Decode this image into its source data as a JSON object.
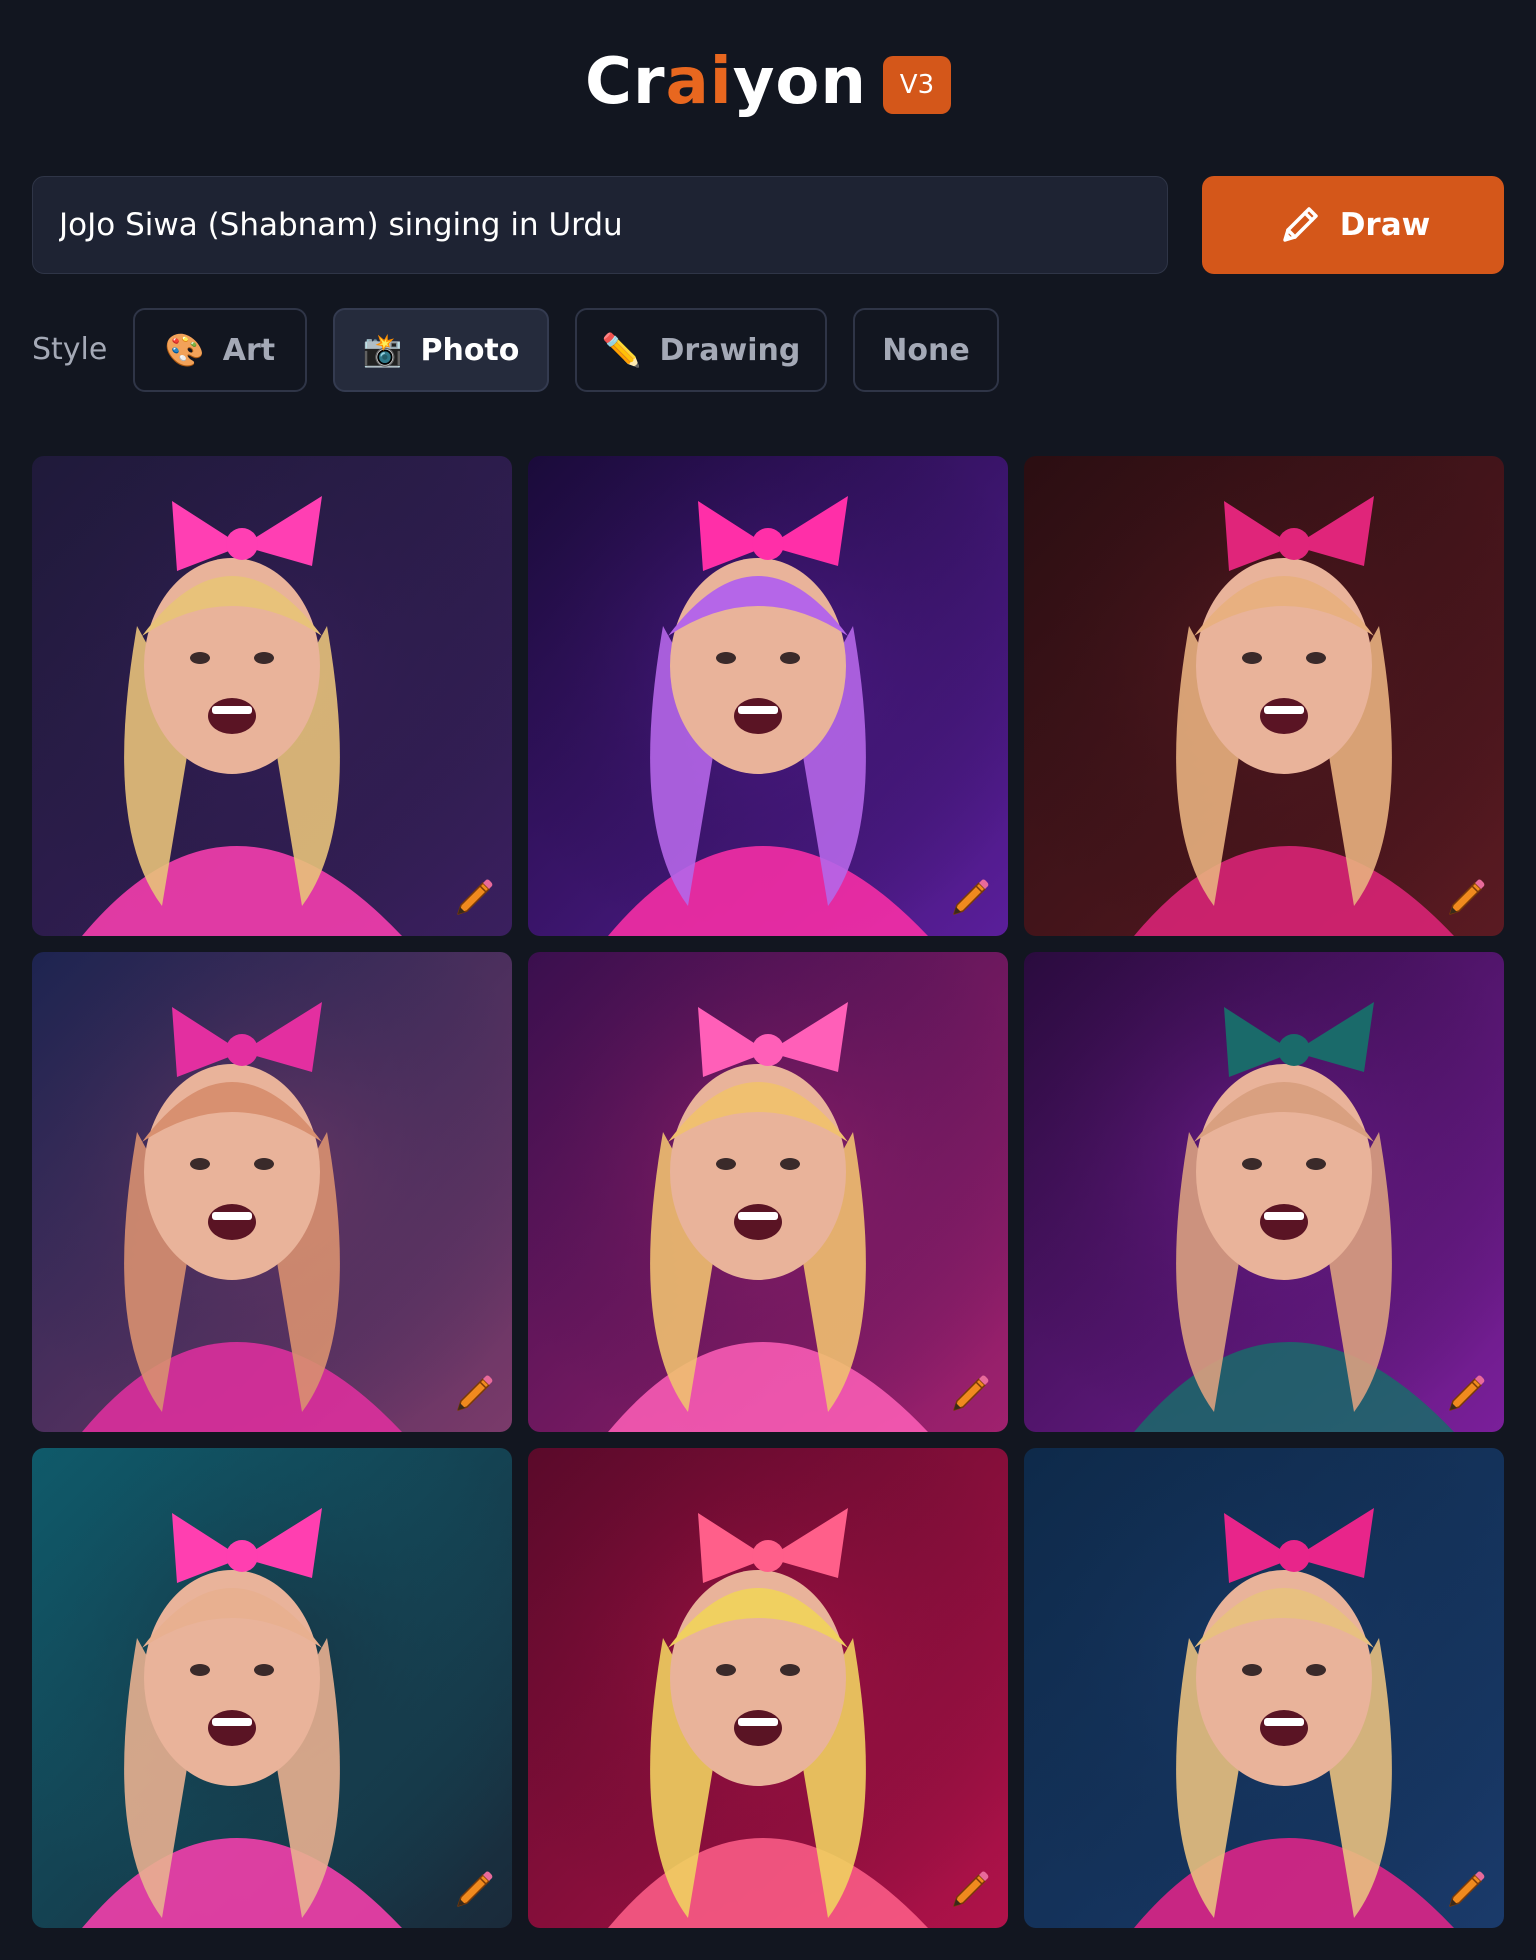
{
  "header": {
    "logo_prefix": "Cr",
    "logo_accent": "ai",
    "logo_suffix": "yon",
    "version": "V3"
  },
  "prompt": {
    "value": "JoJo Siwa (Shabnam) singing in Urdu",
    "draw_label": "Draw",
    "draw_icon": "pencil-icon"
  },
  "style": {
    "label": "Style",
    "options": [
      {
        "label": "Art",
        "icon": "🎨",
        "selected": false
      },
      {
        "label": "Photo",
        "icon": "📸",
        "selected": true
      },
      {
        "label": "Drawing",
        "icon": "✏️",
        "selected": false
      },
      {
        "label": "None",
        "icon": "",
        "selected": false
      }
    ]
  },
  "colors": {
    "background": "#121620",
    "accent": "#d4571a",
    "input_bg": "#1e2333"
  },
  "results": {
    "images": [
      {
        "icon": "pencil-edit-icon",
        "palette": [
          "#1f1a3a",
          "#3a1f5e",
          "#e8c27a",
          "#ff3fb3"
        ]
      },
      {
        "icon": "pencil-edit-icon",
        "palette": [
          "#1a0b3a",
          "#5a1e9a",
          "#b566e8",
          "#ff2fa8"
        ]
      },
      {
        "icon": "pencil-edit-icon",
        "palette": [
          "#2b0e12",
          "#5a1a22",
          "#e8b080",
          "#e0257a"
        ]
      },
      {
        "icon": "pencil-edit-icon",
        "palette": [
          "#1d2450",
          "#7a3a6a",
          "#d89070",
          "#e32fa0"
        ]
      },
      {
        "icon": "pencil-edit-icon",
        "palette": [
          "#3a0f4e",
          "#a0216e",
          "#f0c070",
          "#ff5fb8"
        ]
      },
      {
        "icon": "pencil-edit-icon",
        "palette": [
          "#2a0b3e",
          "#7a1f9a",
          "#d9a080",
          "#1a6a6a"
        ]
      },
      {
        "icon": "pencil-edit-icon",
        "palette": [
          "#0f5a6a",
          "#1a2a3a",
          "#e8b090",
          "#ff3fb0"
        ]
      },
      {
        "icon": "pencil-edit-icon",
        "palette": [
          "#5a0a2a",
          "#b0124a",
          "#f0d060",
          "#ff5f8a"
        ]
      },
      {
        "icon": "pencil-edit-icon",
        "palette": [
          "#0e2a4a",
          "#1a3a6a",
          "#e8c080",
          "#e8258a"
        ]
      }
    ]
  }
}
